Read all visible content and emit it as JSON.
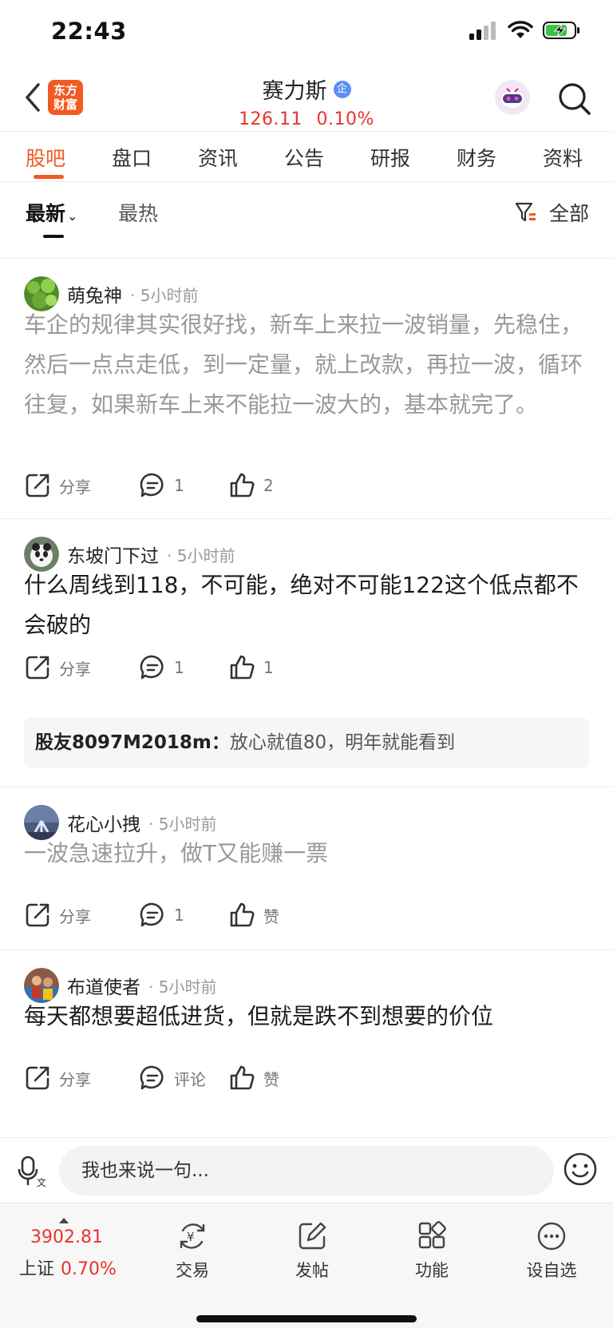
{
  "status_bar": {
    "time": "22:43"
  },
  "header": {
    "logo_text": "东方财富",
    "stock_name": "赛力斯",
    "verify_badge": "企",
    "price": "126.11",
    "change_pct": "0.10%"
  },
  "tabs": [
    {
      "label": "股吧",
      "active": true
    },
    {
      "label": "盘口"
    },
    {
      "label": "资讯"
    },
    {
      "label": "公告"
    },
    {
      "label": "研报"
    },
    {
      "label": "财务"
    },
    {
      "label": "资料"
    }
  ],
  "filter": {
    "latest": "最新",
    "hot": "最热",
    "all": "全部"
  },
  "posts": [
    {
      "user": "萌兔神",
      "time": "5小时前",
      "text": "车企的规律其实很好找，新车上来拉一波销量，先稳住，然后一点点走低，到一定量，就上改款，再拉一波，循环往复，如果新车上来不能拉一波大的，基本就完了。",
      "share": "分享",
      "comments": "1",
      "likes": "2"
    },
    {
      "user": "东坡门下过",
      "time": "5小时前",
      "text": "什么周线到118，不可能，绝对不可能122这个低点都不会破的",
      "share": "分享",
      "comments": "1",
      "likes": "1",
      "reply": {
        "user": "股友8097M2018m：",
        "text": "放心就值80，明年就能看到"
      }
    },
    {
      "user": "花心小拽",
      "time": "5小时前",
      "text": "一波急速拉升，做T又能赚一票",
      "share": "分享",
      "comments": "1",
      "likes": "赞"
    },
    {
      "user": "布道使者",
      "time": "5小时前",
      "text": "每天都想要超低进货，但就是跌不到想要的价位",
      "share": "分享",
      "comments": "评论",
      "likes": "赞"
    }
  ],
  "comment_bar": {
    "placeholder": "我也来说一句..."
  },
  "bottom_nav": {
    "index_value": "3902.81",
    "index_name": "上证",
    "index_pct": "0.70%",
    "items": [
      {
        "label": "交易",
        "icon": "trade-yen-icon"
      },
      {
        "label": "发帖",
        "icon": "edit-post-icon"
      },
      {
        "label": "功能",
        "icon": "grid-apps-icon"
      },
      {
        "label": "设自选",
        "icon": "more-dots-icon"
      }
    ]
  },
  "colors": {
    "accent": "#f15a22",
    "up_red": "#e8332e",
    "link_blue": "#5b8ff5"
  }
}
